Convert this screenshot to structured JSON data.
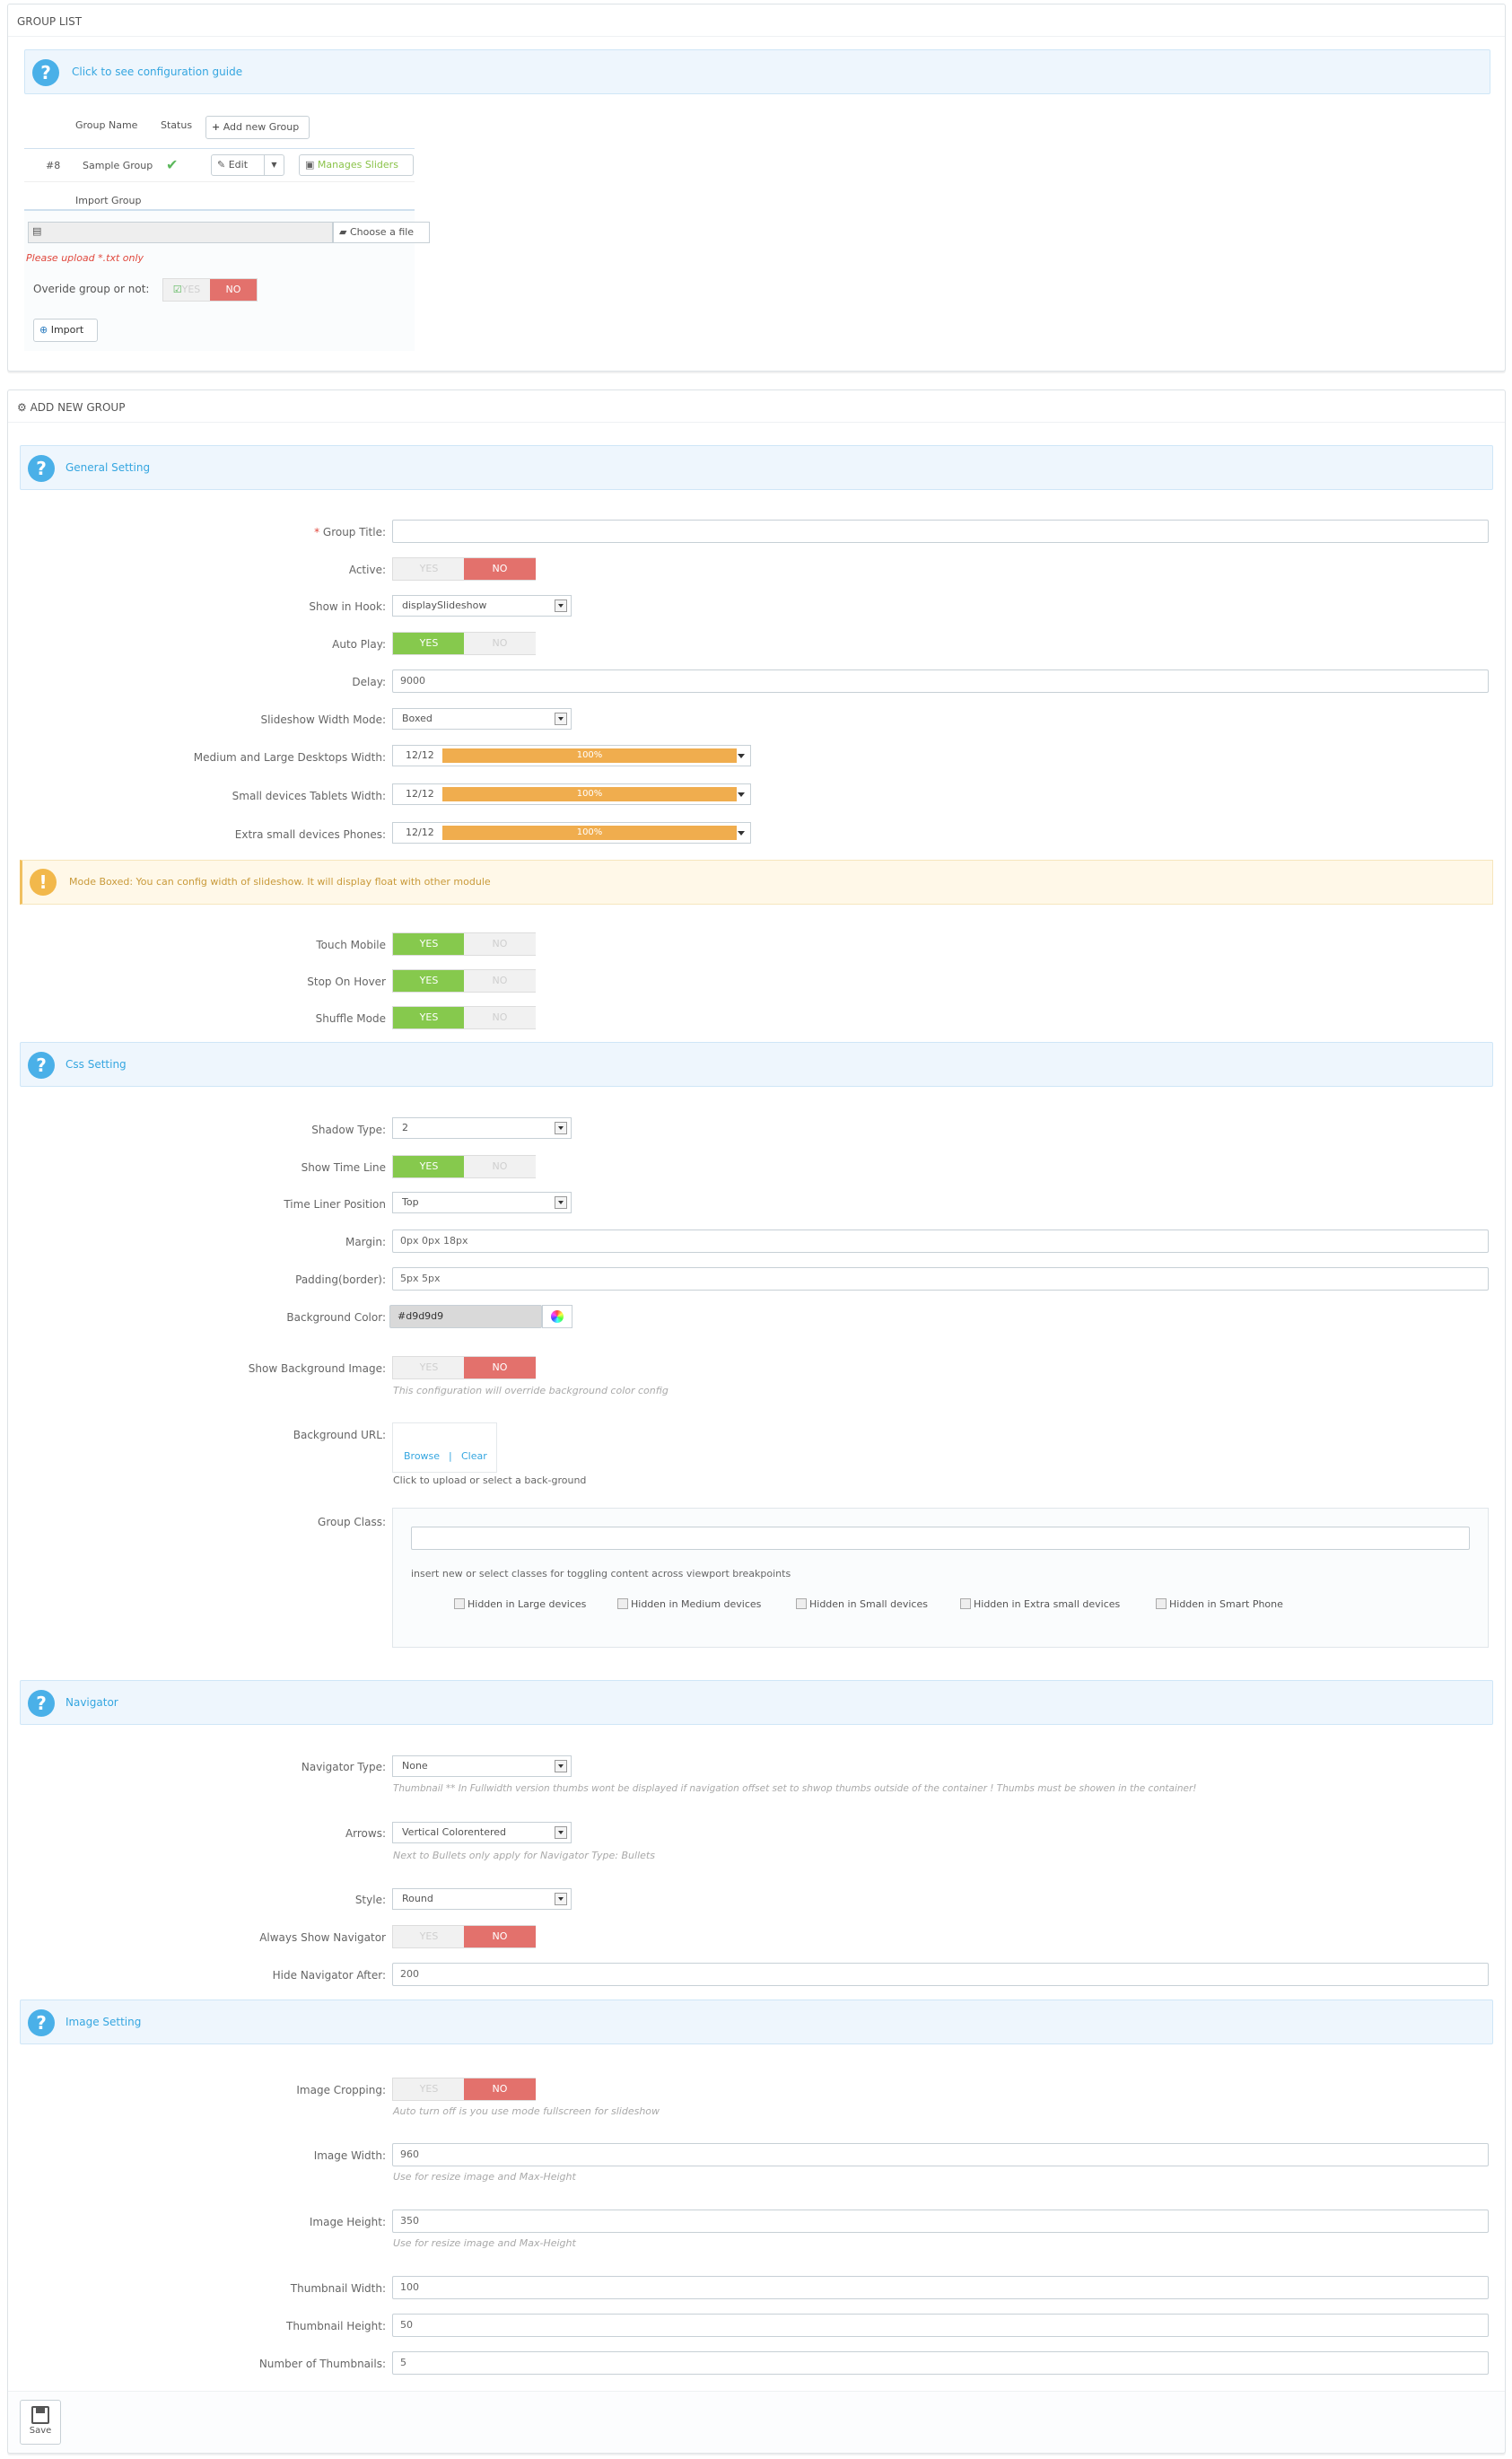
{
  "group_list": {
    "title": "GROUP LIST",
    "guide_link": "Click to see configuration guide",
    "col_group_name": "Group Name",
    "col_status": "Status",
    "add_new_group": "Add new Group",
    "row": {
      "id": "#8",
      "name": "Sample Group",
      "edit": "Edit",
      "manages_sliders": "Manages Sliders"
    },
    "import_group": "Import Group",
    "choose_file": "Choose a file",
    "upload_note": "Please upload *.txt only",
    "override_label": "Overide group or not:",
    "override_yes": "YES",
    "override_no": "NO",
    "import_button": "Import"
  },
  "add_group": {
    "title": "ADD NEW GROUP",
    "general_setting": "General Setting",
    "fields": {
      "group_title": {
        "label": "Group Title:",
        "value": ""
      },
      "active": {
        "label": "Active:",
        "yes": "YES",
        "no": "NO",
        "selected": "no"
      },
      "show_in_hook": {
        "label": "Show in Hook:",
        "value": "displaySlideshow"
      },
      "auto_play": {
        "label": "Auto Play:",
        "yes": "YES",
        "no": "NO",
        "selected": "yes"
      },
      "delay": {
        "label": "Delay:",
        "value": "9000"
      },
      "slideshow_width_mode": {
        "label": "Slideshow Width Mode:",
        "value": "Boxed"
      },
      "width_desktop": {
        "label": "Medium and Large Desktops Width:",
        "value": "12/12",
        "percent": "100%"
      },
      "width_tablet": {
        "label": "Small devices Tablets Width:",
        "value": "12/12",
        "percent": "100%"
      },
      "width_phone": {
        "label": "Extra small devices Phones:",
        "value": "12/12",
        "percent": "100%"
      }
    },
    "warning": "Mode Boxed: You can config width of slideshow. It will display float with other module",
    "touch_mobile": {
      "label": "Touch Mobile",
      "yes": "YES",
      "no": "NO",
      "selected": "yes"
    },
    "stop_on_hover": {
      "label": "Stop On Hover",
      "yes": "YES",
      "no": "NO",
      "selected": "yes"
    },
    "shuffle_mode": {
      "label": "Shuffle Mode",
      "yes": "YES",
      "no": "NO",
      "selected": "yes"
    },
    "css_setting": "Css Setting",
    "shadow_type": {
      "label": "Shadow Type:",
      "value": "2"
    },
    "show_time_line": {
      "label": "Show Time Line",
      "yes": "YES",
      "no": "NO",
      "selected": "yes"
    },
    "time_liner_position": {
      "label": "Time Liner Position",
      "value": "Top"
    },
    "margin": {
      "label": "Margin:",
      "value": "0px 0px 18px"
    },
    "padding": {
      "label": "Padding(border):",
      "value": "5px 5px"
    },
    "background_color": {
      "label": "Background Color:",
      "value": "#d9d9d9"
    },
    "show_background_image": {
      "label": "Show Background Image:",
      "yes": "YES",
      "no": "NO",
      "selected": "no",
      "help": "This configuration will override background color config"
    },
    "background_url": {
      "label": "Background URL:",
      "browse": "Browse",
      "separator": "|",
      "clear": "Clear",
      "help": "Click to upload or select a back-ground"
    },
    "group_class": {
      "label": "Group Class:",
      "value": "",
      "help": "insert new or select classes for toggling content across viewport breakpoints",
      "checkboxes": [
        "Hidden in Large devices",
        "Hidden in Medium devices",
        "Hidden in Small devices",
        "Hidden in Extra small devices",
        "Hidden in Smart Phone"
      ]
    },
    "navigator": "Navigator",
    "navigator_type": {
      "label": "Navigator Type:",
      "value": "None",
      "help": "Thumbnail ** In Fullwidth version thumbs wont be displayed if navigation offset set to shwop thumbs outside of the container ! Thumbs must be showen in the container!"
    },
    "arrows": {
      "label": "Arrows:",
      "value": "Vertical Colorentered",
      "help": "Next to Bullets only apply for Navigator Type: Bullets"
    },
    "style": {
      "label": "Style:",
      "value": "Round"
    },
    "always_show_navigator": {
      "label": "Always Show Navigator",
      "yes": "YES",
      "no": "NO",
      "selected": "no"
    },
    "hide_navigator_after": {
      "label": "Hide Navigator After:",
      "value": "200"
    },
    "image_setting": "Image Setting",
    "image_cropping": {
      "label": "Image Cropping:",
      "yes": "YES",
      "no": "NO",
      "selected": "no",
      "help": "Auto turn off is you use mode fullscreen for slideshow"
    },
    "image_width": {
      "label": "Image Width:",
      "value": "960",
      "help": "Use for resize image and Max-Height"
    },
    "image_height": {
      "label": "Image Height:",
      "value": "350",
      "help": "Use for resize image and Max-Height"
    },
    "thumbnail_width": {
      "label": "Thumbnail Width:",
      "value": "100"
    },
    "thumbnail_height": {
      "label": "Thumbnail Height:",
      "value": "50"
    },
    "number_of_thumbnails": {
      "label": "Number of Thumbnails:",
      "value": "5"
    },
    "save": "Save"
  },
  "colors": {
    "accent": "#35a6e0",
    "yes_green": "#86c94d",
    "no_red": "#e3716c",
    "progress_orange": "#f0ad4e",
    "warning_bg": "#fff8e8"
  }
}
